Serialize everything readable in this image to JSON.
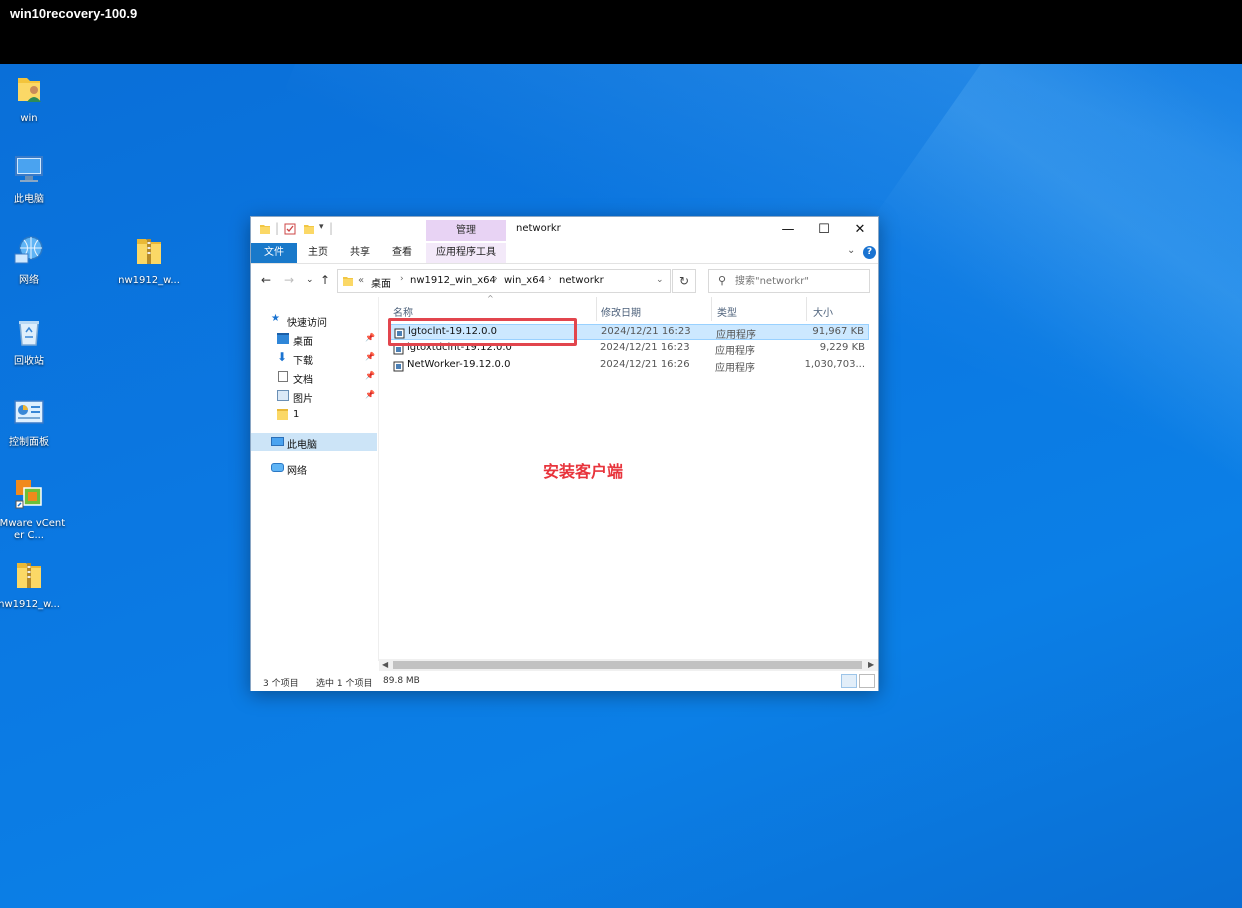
{
  "session": {
    "title": "win10recovery-100.9"
  },
  "desktop_icons": [
    {
      "label": "win",
      "icon": "user-folder-icon"
    },
    {
      "label": "此电脑",
      "icon": "computer-icon"
    },
    {
      "label": "网络",
      "icon": "network-icon"
    },
    {
      "label": "回收站",
      "icon": "recycle-bin-icon"
    },
    {
      "label": "控制面板",
      "icon": "control-panel-icon"
    },
    {
      "label": "VMware vCenter C...",
      "icon": "vmware-icon"
    },
    {
      "label": "nw1912_w...",
      "icon": "zip-folder-icon"
    },
    {
      "label": "nw1912_w...",
      "icon": "zip-folder-icon"
    }
  ],
  "explorer": {
    "title": "networkr",
    "context_tab": "管理",
    "window_controls": {
      "minimize": "—",
      "maximize": "☐",
      "close": "✕"
    },
    "ribbon_tabs": [
      "文件",
      "主页",
      "共享",
      "查看",
      "应用程序工具"
    ],
    "address": {
      "prefix": "«",
      "crumbs": [
        "桌面",
        "nw1912_win_x64",
        "win_x64",
        "networkr"
      ]
    },
    "search": {
      "placeholder": "搜索\"networkr\""
    },
    "nav": {
      "quick_access": "快速访问",
      "items": [
        "桌面",
        "下载",
        "文档",
        "图片",
        "1"
      ],
      "this_pc": "此电脑",
      "network": "网络"
    },
    "columns": [
      "名称",
      "修改日期",
      "类型",
      "大小"
    ],
    "files": [
      {
        "name": "lgtoclnt-19.12.0.0",
        "date": "2024/12/21 16:23",
        "type": "应用程序",
        "size": "91,967 KB",
        "selected": true
      },
      {
        "name": "lgtoxtdclnt-19.12.0.0",
        "date": "2024/12/21 16:23",
        "type": "应用程序",
        "size": "9,229 KB",
        "selected": false
      },
      {
        "name": "NetWorker-19.12.0.0",
        "date": "2024/12/21 16:26",
        "type": "应用程序",
        "size": "1,030,703...",
        "selected": false
      }
    ],
    "status": {
      "count": "3 个项目",
      "selection": "选中 1 个项目",
      "size": "89.8 MB"
    }
  },
  "annotation": {
    "text": "安装客户端",
    "color": "#e8343c"
  },
  "colors": {
    "desktop": "#0b78e2",
    "file_tab": "#1979ca",
    "selection": "#cce8ff",
    "highlight": "#e2454d"
  }
}
